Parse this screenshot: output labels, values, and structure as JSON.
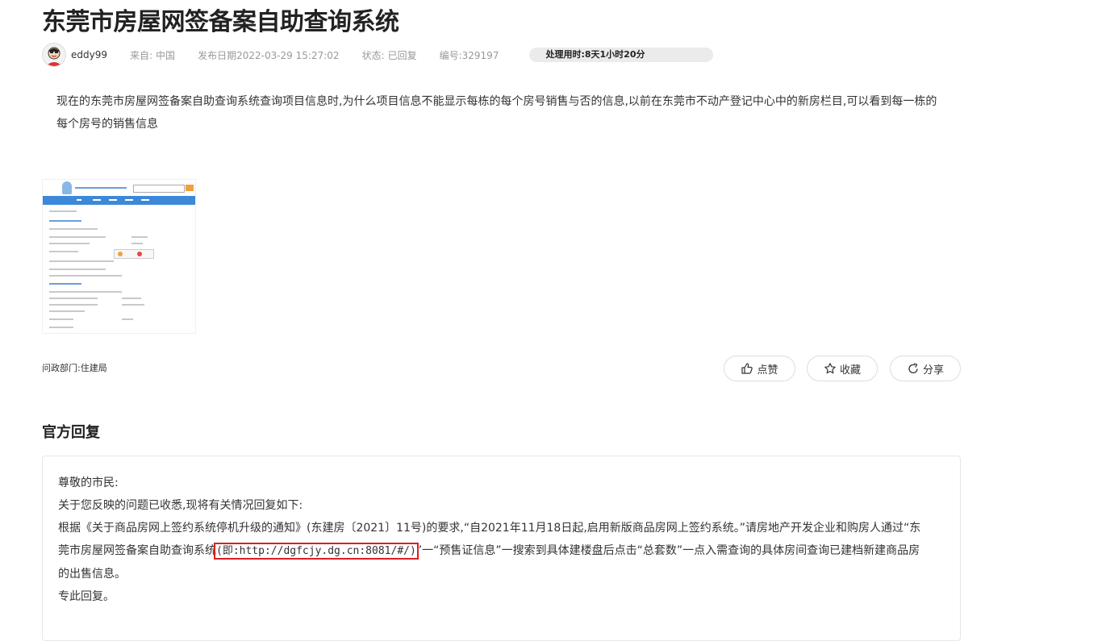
{
  "page": {
    "title": "东莞市房屋网签备案自助查询系统"
  },
  "meta": {
    "author": "eddy99",
    "from_label": "来自:",
    "from_value": "中国",
    "date_label": "发布日期",
    "date_value": "2022-03-29 15:27:02",
    "status_label": "状态:",
    "status_value": "已回复",
    "id_label": "编号:",
    "id_value": "329197",
    "duration": "处理用时:8天1小时20分"
  },
  "question": {
    "text": "现在的东莞市房屋网签备案自助查询系统查询项目信息时,为什么项目信息不能显示每栋的每个房号销售与否的信息,以前在东莞市不动产登记中心中的新房栏目,可以看到每一栋的每个房号的销售信息"
  },
  "department": {
    "label": "问政部门:",
    "value": "住建局"
  },
  "actions": {
    "like": "点赞",
    "favorite": "收藏",
    "share": "分享"
  },
  "reply": {
    "section_title": "官方回复",
    "greeting": "尊敬的市民:",
    "intro": "关于您反映的问题已收悉,现将有关情况回复如下:",
    "body_before": "根据《关于商品房网上签约系统停机升级的通知》(东建房〔2021〕11号)的要求,“自2021年11月18日起,启用新版商品房网上签约系统。”请房地产开发企业和购房人通过“东莞市房屋网签备案自助查询系统",
    "body_highlight": "(即:http://dgfcjy.dg.cn:8081/#/)",
    "body_after": "”一“预售证信息”一搜索到具体建楼盘后点击“总套数”一点入需查询的具体房间查询已建档新建商品房的出售信息。",
    "closing": "专此回复。"
  },
  "colors": {
    "highlight_border": "#d9201f",
    "nav_blue": "#3d88d8"
  }
}
